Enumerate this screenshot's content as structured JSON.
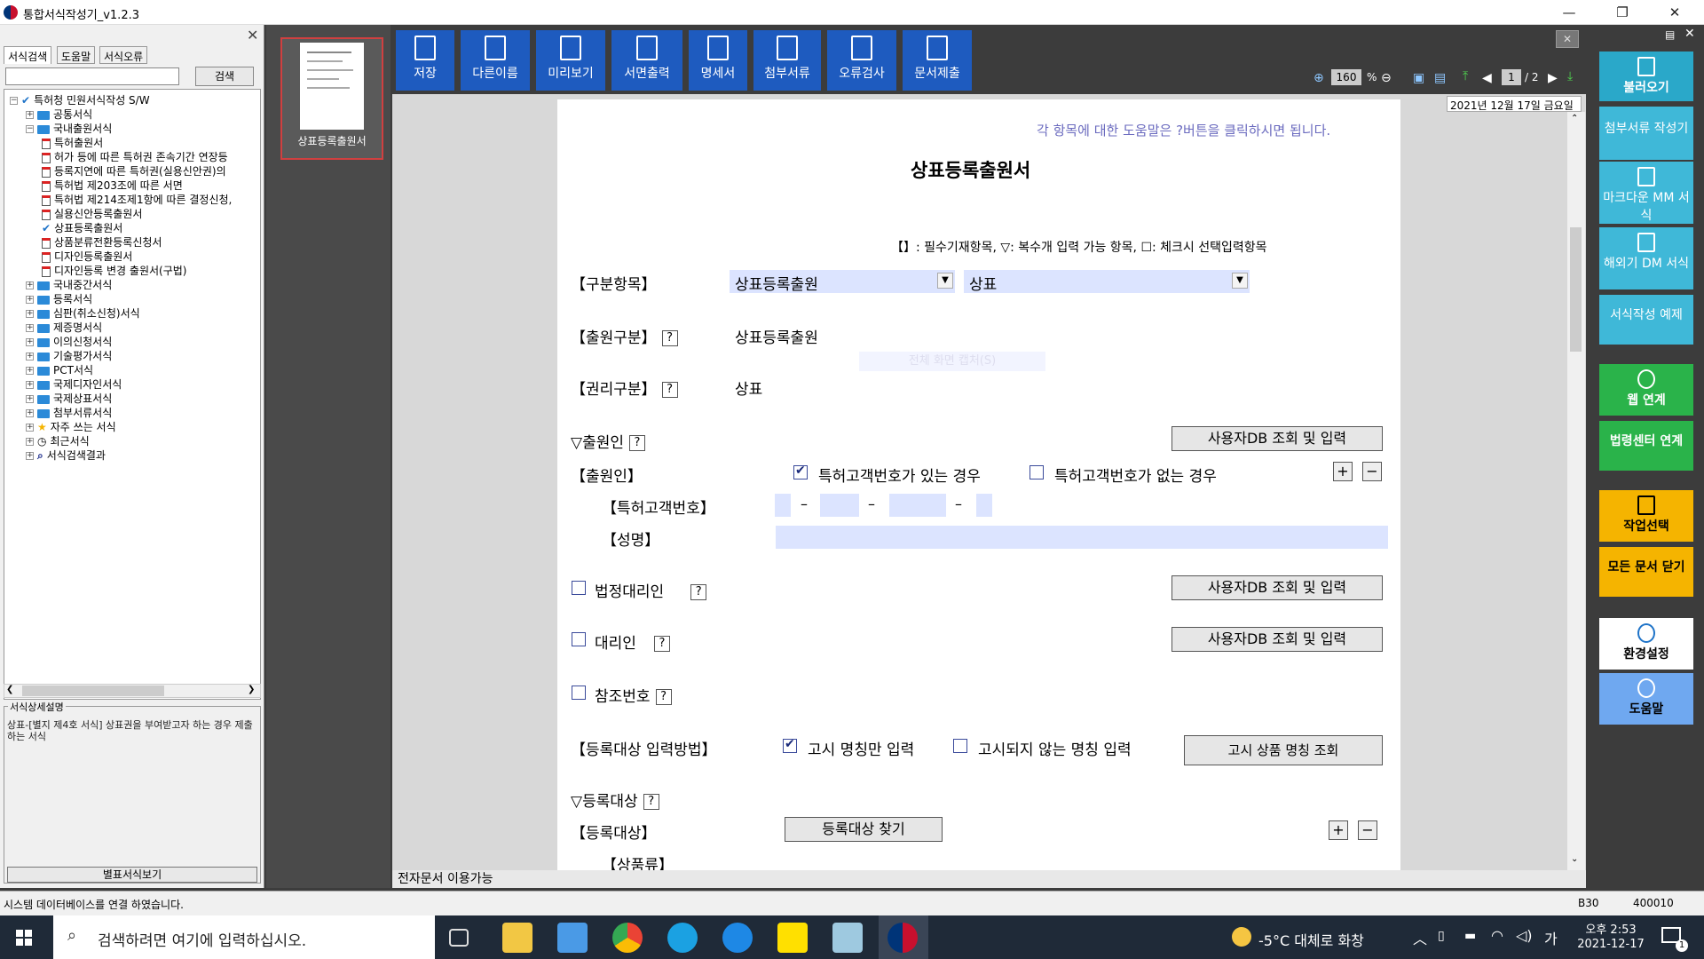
{
  "window": {
    "title": "통합서식작성기_v1.2.3",
    "min": "—",
    "max": "❐",
    "close": "✕"
  },
  "left": {
    "tabs": [
      "서식검색",
      "도움말",
      "서식오류"
    ],
    "search_button": "검색",
    "tree": [
      {
        "label": "특허청 민원서식작성 S/W",
        "level": 0,
        "icon": "check"
      },
      {
        "label": "공통서식",
        "level": 1,
        "icon": "folder"
      },
      {
        "label": "국내출원서식",
        "level": 1,
        "icon": "folder",
        "open": true
      },
      {
        "label": "특허출원서",
        "level": 2,
        "icon": "doc"
      },
      {
        "label": "허가 등에 따른 특허권 존속기간 연장등",
        "level": 2,
        "icon": "doc"
      },
      {
        "label": "등록지연에 따른 특허권(실용신안권)의",
        "level": 2,
        "icon": "doc"
      },
      {
        "label": "특허법 제203조에 따른 서면",
        "level": 2,
        "icon": "doc"
      },
      {
        "label": "특허법 제214조제1항에 따른 결정신청,",
        "level": 2,
        "icon": "doc"
      },
      {
        "label": "실용신안등록출원서",
        "level": 2,
        "icon": "doc"
      },
      {
        "label": "상표등록출원서",
        "level": 2,
        "icon": "check"
      },
      {
        "label": "상품분류전환등록신청서",
        "level": 2,
        "icon": "doc"
      },
      {
        "label": "디자인등록출원서",
        "level": 2,
        "icon": "doc"
      },
      {
        "label": "디자인등록 변경 출원서(구법)",
        "level": 2,
        "icon": "doc"
      },
      {
        "label": "국내중간서식",
        "level": 1,
        "icon": "folder"
      },
      {
        "label": "등록서식",
        "level": 1,
        "icon": "folder"
      },
      {
        "label": "심판(취소신청)서식",
        "level": 1,
        "icon": "folder"
      },
      {
        "label": "제증명서식",
        "level": 1,
        "icon": "folder"
      },
      {
        "label": "이의신청서식",
        "level": 1,
        "icon": "folder"
      },
      {
        "label": "기술평가서식",
        "level": 1,
        "icon": "folder"
      },
      {
        "label": "PCT서식",
        "level": 1,
        "icon": "folder"
      },
      {
        "label": "국제디자인서식",
        "level": 1,
        "icon": "folder"
      },
      {
        "label": "국제상표서식",
        "level": 1,
        "icon": "folder"
      },
      {
        "label": "첨부서류서식",
        "level": 1,
        "icon": "folder"
      },
      {
        "label": "자주 쓰는 서식",
        "level": 1,
        "icon": "star"
      },
      {
        "label": "최근서식",
        "level": 1,
        "icon": "clock"
      },
      {
        "label": "서식검색결과",
        "level": 1,
        "icon": "search"
      }
    ],
    "desc_title": "서식상세설명",
    "desc_text": "상표-[별지 제4호 서식] 상표권을 부여받고자 하는 경우 제출하는 서식",
    "preview_button": "별표서식보기"
  },
  "thumb": {
    "label": "상표등록출원서"
  },
  "toolbar": {
    "buttons": [
      "저장",
      "다른이름",
      "미리보기",
      "서면출력",
      "명세서",
      "첨부서류",
      "오류검사",
      "문서제출"
    ],
    "zoom": "160",
    "zoom_unit": "%",
    "page_current": "1",
    "page_total": "/ 2"
  },
  "doc": {
    "date": "2021년 12월 17일 금요일",
    "help_hint": "각 항목에 대한 도움말은 ?버튼을 클릭하시면 됩니다.",
    "title": "상표등록출원서",
    "legend": "【】: 필수기재항목,  ▽: 복수개 입력 가능 항목,  ☐: 체크시 선택입력항목",
    "gubun_label": "【구분항목】",
    "gubun_value1": "상표등록출원",
    "gubun_value2": "상표",
    "chulwon_gubun_label": "【출원구분】",
    "chulwon_gubun_value": "상표등록출원",
    "fullscreen_hint": "전체 화면 캡처(S)",
    "gwonri_label": "【권리구분】",
    "gwonri_value": "상표",
    "applicant_section": "▽출원인",
    "db_button": "사용자DB 조회 및 입력",
    "applicant_label": "【출원인】",
    "has_number": "특허고객번호가 있는 경우",
    "no_number": "특허고객번호가 없는 경우",
    "customer_no_label": "【특허고객번호】",
    "name_label": "【성명】",
    "legal_agent": "법정대리인",
    "agent": "대리인",
    "ref_no": "참조번호",
    "reg_method_label": "【등록대상 입력방법】",
    "notice_only": "고시 명칭만 입력",
    "not_notice": "고시되지 않는 명칭 입력",
    "notice_search_button": "고시 상품 명칭 조회",
    "reg_target_section": "▽등록대상",
    "reg_target_label": "【등록대상】",
    "reg_target_button": "등록대상 찾기",
    "goods_class_label": "【상품류】",
    "status_doc": "전자문서 이용가능"
  },
  "right": {
    "buttons": [
      "불러오기",
      "첨부서류 작성기",
      "마크다운 MM 서식",
      "해외기 DM 서식",
      "서식작성 예제",
      "웹 연계",
      "법령센터 연계",
      "작업선택",
      "모든 문서 닫기",
      "환경설정",
      "도움말"
    ]
  },
  "statusbar": {
    "message": "시스템 데이터베이스를 연결 하였습니다.",
    "code1": "B30",
    "code2": "400010"
  },
  "taskbar": {
    "search_placeholder": "검색하려면 여기에 입력하십시오.",
    "weather": "-5°C 대체로 화창",
    "ime": "가",
    "time": "오후 2:53",
    "date": "2021-12-17",
    "notif_count": "1"
  }
}
